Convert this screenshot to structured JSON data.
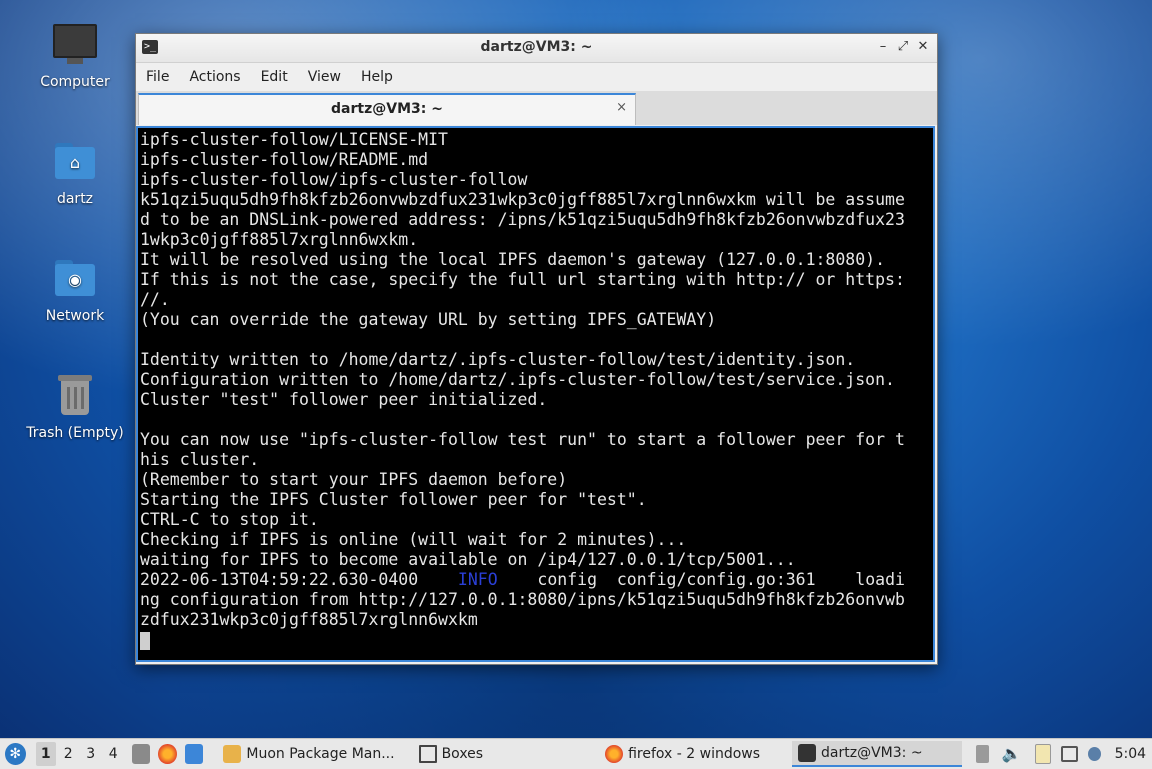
{
  "desktop": {
    "icons": [
      {
        "label": "Computer",
        "icon": "computer-icon"
      },
      {
        "label": "dartz",
        "icon": "home-folder-icon"
      },
      {
        "label": "Network",
        "icon": "network-folder-icon"
      },
      {
        "label": "Trash (Empty)",
        "icon": "trash-icon"
      }
    ]
  },
  "window": {
    "title": "dartz@VM3: ~",
    "controls": {
      "minimize": "–",
      "maximize": "⤢",
      "close": "✕"
    },
    "menu": [
      "File",
      "Actions",
      "Edit",
      "View",
      "Help"
    ],
    "tab": {
      "label": "dartz@VM3: ~",
      "close": "×"
    }
  },
  "terminal": {
    "lines": [
      "ipfs-cluster-follow/LICENSE-MIT",
      "ipfs-cluster-follow/README.md",
      "ipfs-cluster-follow/ipfs-cluster-follow",
      "k51qzi5uqu5dh9fh8kfzb26onvwbzdfux231wkp3c0jgff885l7xrglnn6wxkm will be assume",
      "d to be an DNSLink-powered address: /ipns/k51qzi5uqu5dh9fh8kfzb26onvwbzdfux23",
      "1wkp3c0jgff885l7xrglnn6wxkm.",
      "It will be resolved using the local IPFS daemon's gateway (127.0.0.1:8080).",
      "If this is not the case, specify the full url starting with http:// or https:",
      "//.",
      "(You can override the gateway URL by setting IPFS_GATEWAY)",
      "",
      "Identity written to /home/dartz/.ipfs-cluster-follow/test/identity.json.",
      "Configuration written to /home/dartz/.ipfs-cluster-follow/test/service.json.",
      "Cluster \"test\" follower peer initialized.",
      "",
      "You can now use \"ipfs-cluster-follow test run\" to start a follower peer for t",
      "his cluster.",
      "(Remember to start your IPFS daemon before)",
      "Starting the IPFS Cluster follower peer for \"test\".",
      "CTRL-C to stop it.",
      "Checking if IPFS is online (will wait for 2 minutes)...",
      "waiting for IPFS to become available on /ip4/127.0.0.1/tcp/5001..."
    ],
    "log_line": {
      "timestamp": "2022-06-13T04:59:22.630-0400",
      "level": "INFO",
      "rest": "config  config/config.go:361    loadi"
    },
    "continued_lines": [
      "ng configuration from http://127.0.0.1:8080/ipns/k51qzi5uqu5dh9fh8kfzb26onvwb",
      "zdfux231wkp3c0jgff885l7xrglnn6wxkm"
    ],
    "info_color": "#2a3fd6"
  },
  "taskbar": {
    "workspaces": [
      "1",
      "2",
      "3",
      "4"
    ],
    "active_workspace": "1",
    "tasks": [
      {
        "label": "Muon Package Man...",
        "icon": "package-manager-icon"
      },
      {
        "label": "Boxes",
        "icon": "boxes-icon"
      },
      {
        "label": "firefox - 2 windows",
        "icon": "firefox-icon"
      },
      {
        "label": "dartz@VM3: ~",
        "icon": "terminal-icon"
      }
    ],
    "clock": "5:04"
  }
}
